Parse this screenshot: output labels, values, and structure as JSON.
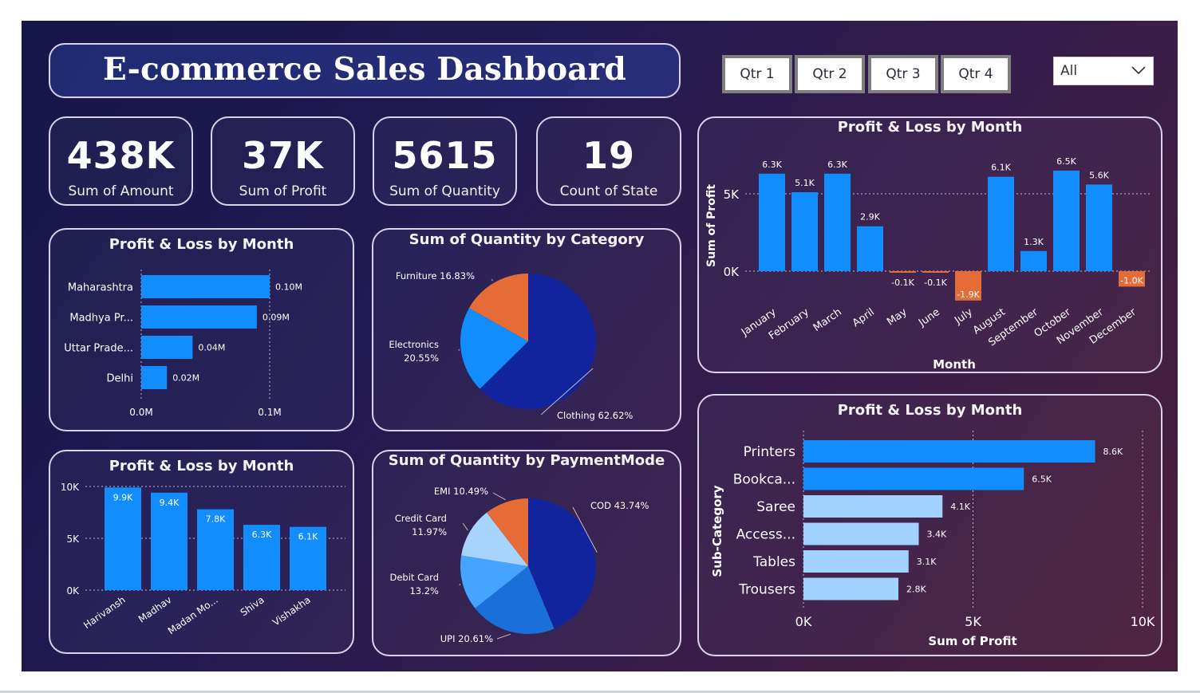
{
  "header": {
    "title": "E-commerce Sales Dashboard"
  },
  "quarters": [
    "Qtr 1",
    "Qtr 2",
    "Qtr 3",
    "Qtr 4"
  ],
  "slicer": {
    "value": "All"
  },
  "kpis": [
    {
      "value": "438K",
      "label": "Sum of Amount"
    },
    {
      "value": "37K",
      "label": "Sum of Profit"
    },
    {
      "value": "5615",
      "label": "Sum of Quantity"
    },
    {
      "value": "19",
      "label": "Count of State"
    }
  ],
  "colors": {
    "bar": "#118dff",
    "negative": "#e66c37",
    "light_bar": "#a0d1ff",
    "grid": "#b8b8c8"
  },
  "chart_data": [
    {
      "id": "state",
      "type": "bar",
      "orientation": "horizontal",
      "title": "Profit & Loss by Month",
      "categories": [
        "Maharashtra",
        "Madhya Pr...",
        "Uttar Prade...",
        "Delhi"
      ],
      "values": [
        0.1,
        0.09,
        0.04,
        0.02
      ],
      "labels": [
        "0.10M",
        "0.09M",
        "0.04M",
        "0.02M"
      ],
      "xlim": [
        0,
        0.1
      ],
      "ticks": [
        "0.0M",
        "0.1M"
      ]
    },
    {
      "id": "customer",
      "type": "bar",
      "title": "Profit & Loss by Month",
      "categories": [
        "Harivansh",
        "Madhav",
        "Madan Mo...",
        "Shiva",
        "Vishakha"
      ],
      "values": [
        9.9,
        9.4,
        7.8,
        6.3,
        6.1
      ],
      "labels": [
        "9.9K",
        "9.4K",
        "7.8K",
        "6.3K",
        "6.1K"
      ],
      "ylim": [
        0,
        10
      ],
      "ticks": [
        "0K",
        "5K",
        "10K"
      ]
    },
    {
      "id": "category",
      "type": "pie",
      "title": "Sum of Quantity by Category",
      "slices": [
        {
          "name": "Clothing",
          "value": 62.62,
          "label": "Clothing 62.62%",
          "color": "#12239e"
        },
        {
          "name": "Electronics",
          "value": 20.55,
          "label": "Electronics 20.55%",
          "color": "#118dff"
        },
        {
          "name": "Furniture",
          "value": 16.83,
          "label": "Furniture 16.83%",
          "color": "#e66c37"
        }
      ]
    },
    {
      "id": "payment",
      "type": "pie",
      "title": "Sum of Quantity by PaymentMode",
      "slices": [
        {
          "name": "COD",
          "value": 43.74,
          "label": "COD 43.74%",
          "color": "#12239e"
        },
        {
          "name": "UPI",
          "value": 20.61,
          "label": "UPI 20.61%",
          "color": "#1a6fd8"
        },
        {
          "name": "Debit Card",
          "value": 13.2,
          "label": "Debit Card 13.2%",
          "color": "#44a4ff"
        },
        {
          "name": "Credit Card",
          "value": 11.97,
          "label": "Credit Card 11.97%",
          "color": "#a7d3ff"
        },
        {
          "name": "EMI",
          "value": 10.49,
          "label": "EMI 10.49%",
          "color": "#e66c37"
        }
      ]
    },
    {
      "id": "month",
      "type": "bar",
      "title": "Profit & Loss by Month",
      "xlabel": "Month",
      "ylabel": "Sum of Profit",
      "categories": [
        "January",
        "February",
        "March",
        "April",
        "May",
        "June",
        "July",
        "August",
        "September",
        "October",
        "November",
        "December"
      ],
      "values": [
        6.3,
        5.1,
        6.3,
        2.9,
        -0.1,
        -0.1,
        -1.9,
        6.1,
        1.3,
        6.5,
        5.6,
        -1.0
      ],
      "labels": [
        "6.3K",
        "5.1K",
        "6.3K",
        "2.9K",
        "-0.1K",
        "-0.1K",
        "-1.9K",
        "6.1K",
        "1.3K",
        "6.5K",
        "5.6K",
        "-1.0K"
      ],
      "ticks": [
        "0K",
        "5K"
      ]
    },
    {
      "id": "subcategory",
      "type": "bar",
      "orientation": "horizontal",
      "title": "Profit & Loss by Month",
      "xlabel": "Sum of Profit",
      "ylabel": "Sub-Category",
      "categories": [
        "Printers",
        "Bookca...",
        "Saree",
        "Access...",
        "Tables",
        "Trousers"
      ],
      "values": [
        8.6,
        6.5,
        4.1,
        3.4,
        3.1,
        2.8
      ],
      "labels": [
        "8.6K",
        "6.5K",
        "4.1K",
        "3.4K",
        "3.1K",
        "2.8K"
      ],
      "xlim": [
        0,
        10
      ],
      "ticks": [
        "0K",
        "5K",
        "10K"
      ]
    }
  ]
}
